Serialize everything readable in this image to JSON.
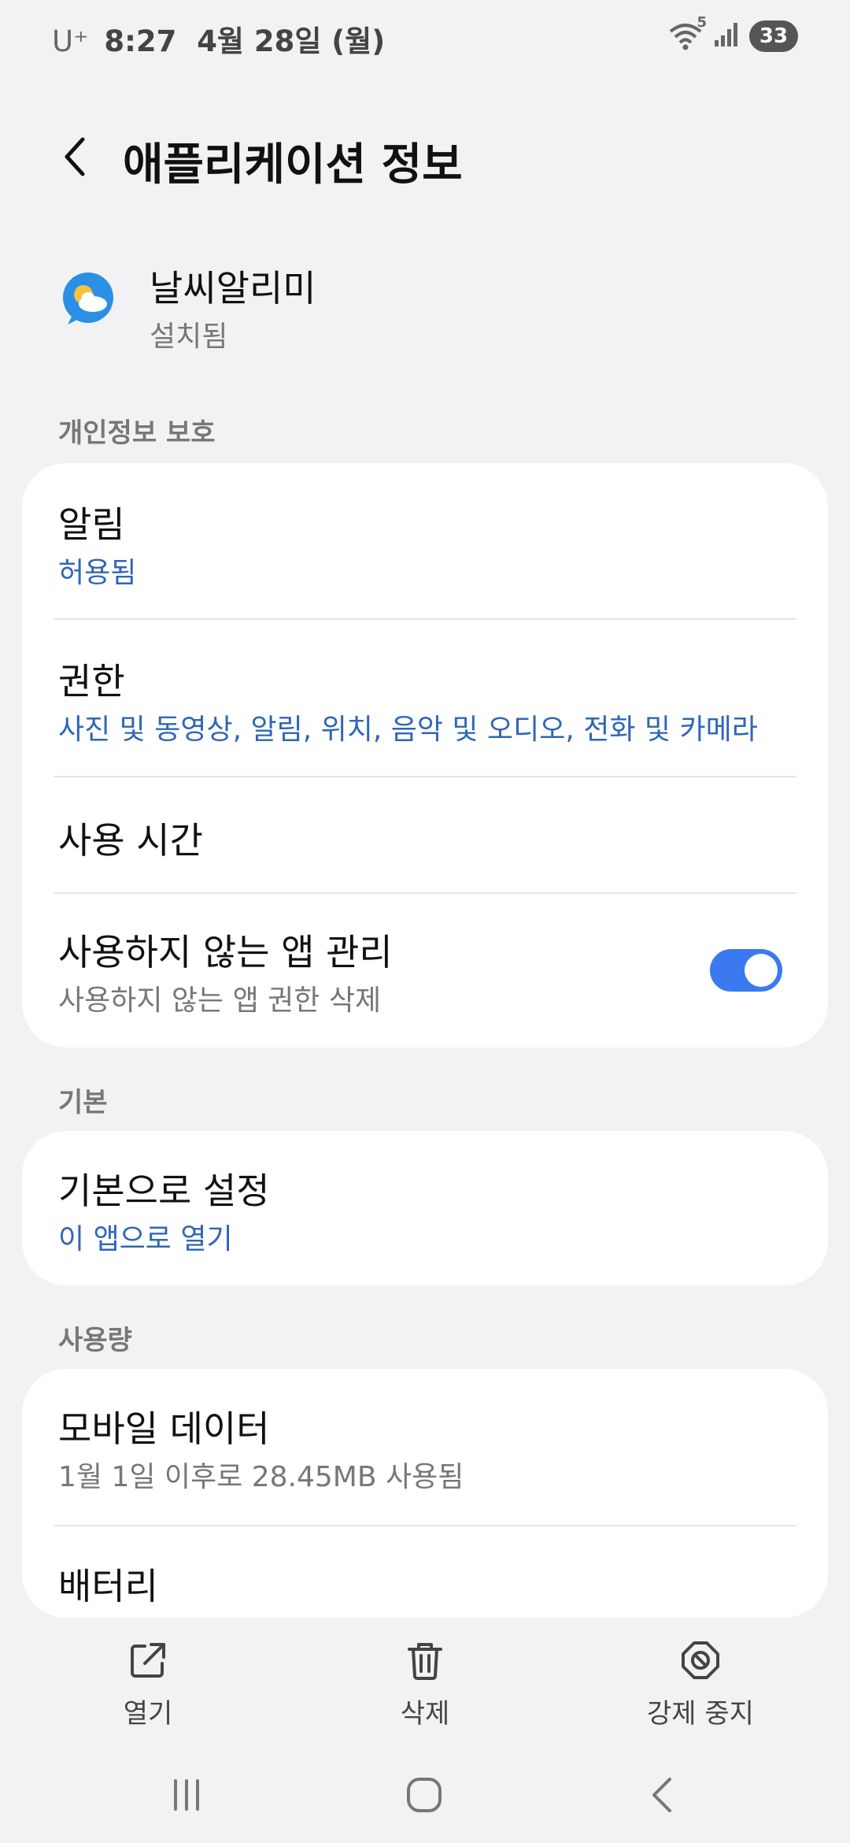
{
  "status_bar": {
    "carrier": "U⁺",
    "time": "8:27",
    "date": "4월 28일 (월)",
    "network": "5",
    "battery": "33"
  },
  "header": {
    "title": "애플리케이션 정보"
  },
  "app": {
    "name": "날씨알리미",
    "status": "설치됨",
    "icon": "weather-app-icon"
  },
  "sections": {
    "privacy": {
      "title": "개인정보 보호",
      "notifications": {
        "label": "알림",
        "value": "허용됨"
      },
      "permissions": {
        "label": "권한",
        "value": "사진 및 동영상, 알림, 위치, 음악 및 오디오, 전화 및 카메라"
      },
      "screen_time": {
        "label": "사용 시간"
      },
      "unused_apps": {
        "label": "사용하지 않는 앱 관리",
        "value": "사용하지 않는 앱 권한 삭제",
        "enabled": true
      }
    },
    "defaults": {
      "title": "기본",
      "set_default": {
        "label": "기본으로 설정",
        "value": "이 앱으로 열기"
      }
    },
    "usage": {
      "title": "사용량",
      "mobile_data": {
        "label": "모바일 데이터",
        "value": "1월 1일 이후로 28.45MB 사용됨"
      },
      "battery": {
        "label": "배터리"
      }
    }
  },
  "actions": {
    "open": "열기",
    "uninstall": "삭제",
    "force_stop": "강제 중지"
  },
  "colors": {
    "accent": "#3b79f0",
    "link": "#2f66b8",
    "background": "#f2f2f4"
  }
}
